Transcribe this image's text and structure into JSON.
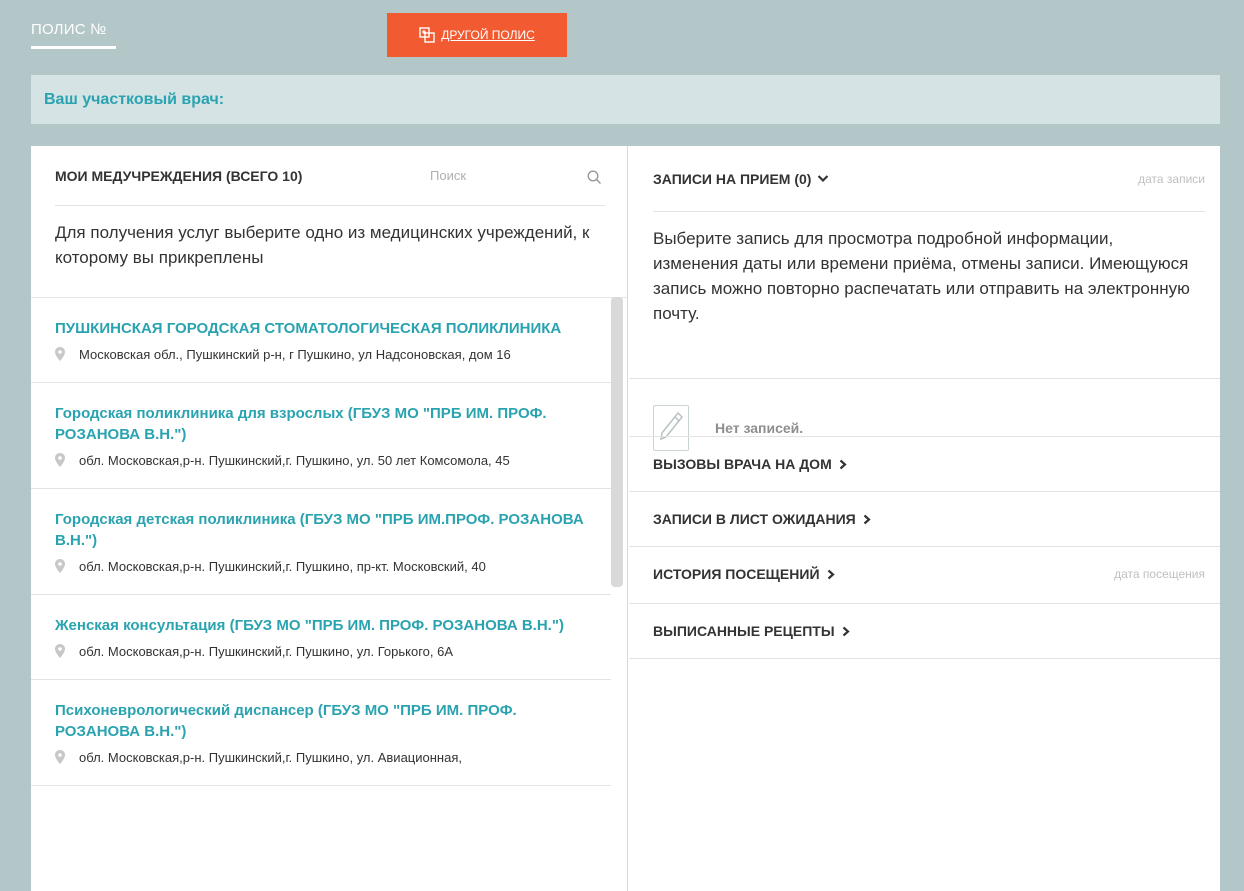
{
  "header": {
    "policy_tab_label": "ПОЛИС №",
    "other_policy_label": "другой полис"
  },
  "doctor_banner": {
    "title": "Ваш участковый врач:"
  },
  "institutions": {
    "title": "МОИ МЕДУЧРЕЖДЕНИЯ (ВСЕГО 10)",
    "search_placeholder": "Поиск",
    "description": "Для получения услуг выберите одно из медицинских учреждений, к которому вы прикреплены",
    "items": [
      {
        "name": "ПУШКИНСКАЯ ГОРОДСКАЯ СТОМАТОЛОГИЧЕСКАЯ ПОЛИКЛИНИКА",
        "address": "Московская обл., Пушкинский р-н, г Пушкино, ул Надсоновская, дом 16"
      },
      {
        "name": "Городская поликлиника для взрослых (ГБУЗ МО \"ПРБ ИМ. ПРОФ. РОЗАНОВА В.Н.\")",
        "address": "обл. Московская,р-н. Пушкинский,г. Пушкино, ул. 50 лет Комсомола, 45"
      },
      {
        "name": "Городская детская поликлиника (ГБУЗ МО \"ПРБ ИМ.ПРОФ. РОЗАНОВА В.Н.\")",
        "address": "обл. Московская,р-н. Пушкинский,г. Пушкино, пр-кт. Московский, 40"
      },
      {
        "name": "Женская консультация (ГБУЗ МО \"ПРБ ИМ. ПРОФ. РОЗАНОВА В.Н.\")",
        "address": "обл. Московская,р-н. Пушкинский,г. Пушкино, ул. Горького, 6А"
      },
      {
        "name": "Психоневрологический диспансер (ГБУЗ МО \"ПРБ ИМ. ПРОФ. РОЗАНОВА В.Н.\")",
        "address": "обл. Московская,р-н. Пушкинский,г. Пушкино, ул. Авиационная,"
      }
    ]
  },
  "appointments": {
    "title": "ЗАПИСИ НА ПРИЕМ (0)",
    "date_hint": "дата записи",
    "description": "Выберите запись для просмотра подробной информации, изменения даты или времени приёма, отмены записи. Имеющуюся запись можно повторно распечатать или отправить на электронную почту.",
    "empty_text": "Нет записей."
  },
  "sections": {
    "home_calls": "ВЫЗОВЫ ВРАЧА НА ДОМ",
    "waiting_list": "ЗАПИСИ В ЛИСТ ОЖИДАНИЯ",
    "visit_history": "ИСТОРИЯ ПОСЕЩЕНИЙ",
    "visit_history_hint": "дата посещения",
    "prescriptions": "ВЫПИСАННЫЕ РЕЦЕПТЫ"
  },
  "colors": {
    "page_bg": "#b3c6c8",
    "accent_orange": "#f25b32",
    "link_teal": "#2aa3b0",
    "banner_bg": "#d5e3e4"
  },
  "icons": {
    "switch_policy": "switch-policy-icon",
    "search": "search-icon",
    "pin": "location-pin-icon",
    "pencil": "pencil-icon",
    "chevron_down": "chevron-down-icon",
    "chevron_right": "chevron-right-icon"
  }
}
